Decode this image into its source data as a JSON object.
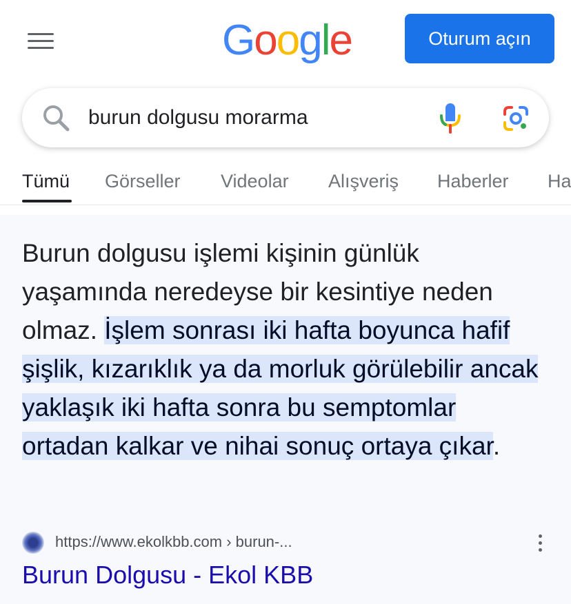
{
  "header": {
    "logo_text": "Google",
    "signin_label": "Oturum açın"
  },
  "search": {
    "query": "burun dolgusu morarma"
  },
  "tabs": [
    {
      "label": "Tümü",
      "active": true
    },
    {
      "label": "Görseller",
      "active": false
    },
    {
      "label": "Videolar",
      "active": false
    },
    {
      "label": "Alışveriş",
      "active": false
    },
    {
      "label": "Haberler",
      "active": false
    },
    {
      "label": "Ha",
      "active": false
    }
  ],
  "featured_snippet": {
    "text_before": "Burun dolgusu işlemi kişinin günlük yaşamında neredeyse bir kesintiye neden olmaz. ",
    "highlighted": "İşlem sonrası iki hafta boyunca hafif şişlik, kızarıklık ya da morluk görülebilir ancak yaklaşık iki hafta sonra bu semptomlar ortadan kalkar ve nihai sonuç ortaya çıkar",
    "text_after": "."
  },
  "result": {
    "url": "https://www.ekolkbb.com › burun-...",
    "title": "Burun Dolgusu - Ekol KBB"
  },
  "colors": {
    "accent_blue": "#1a73e8",
    "link_blue": "#1a0dab",
    "highlight": "#dbe6fb"
  }
}
